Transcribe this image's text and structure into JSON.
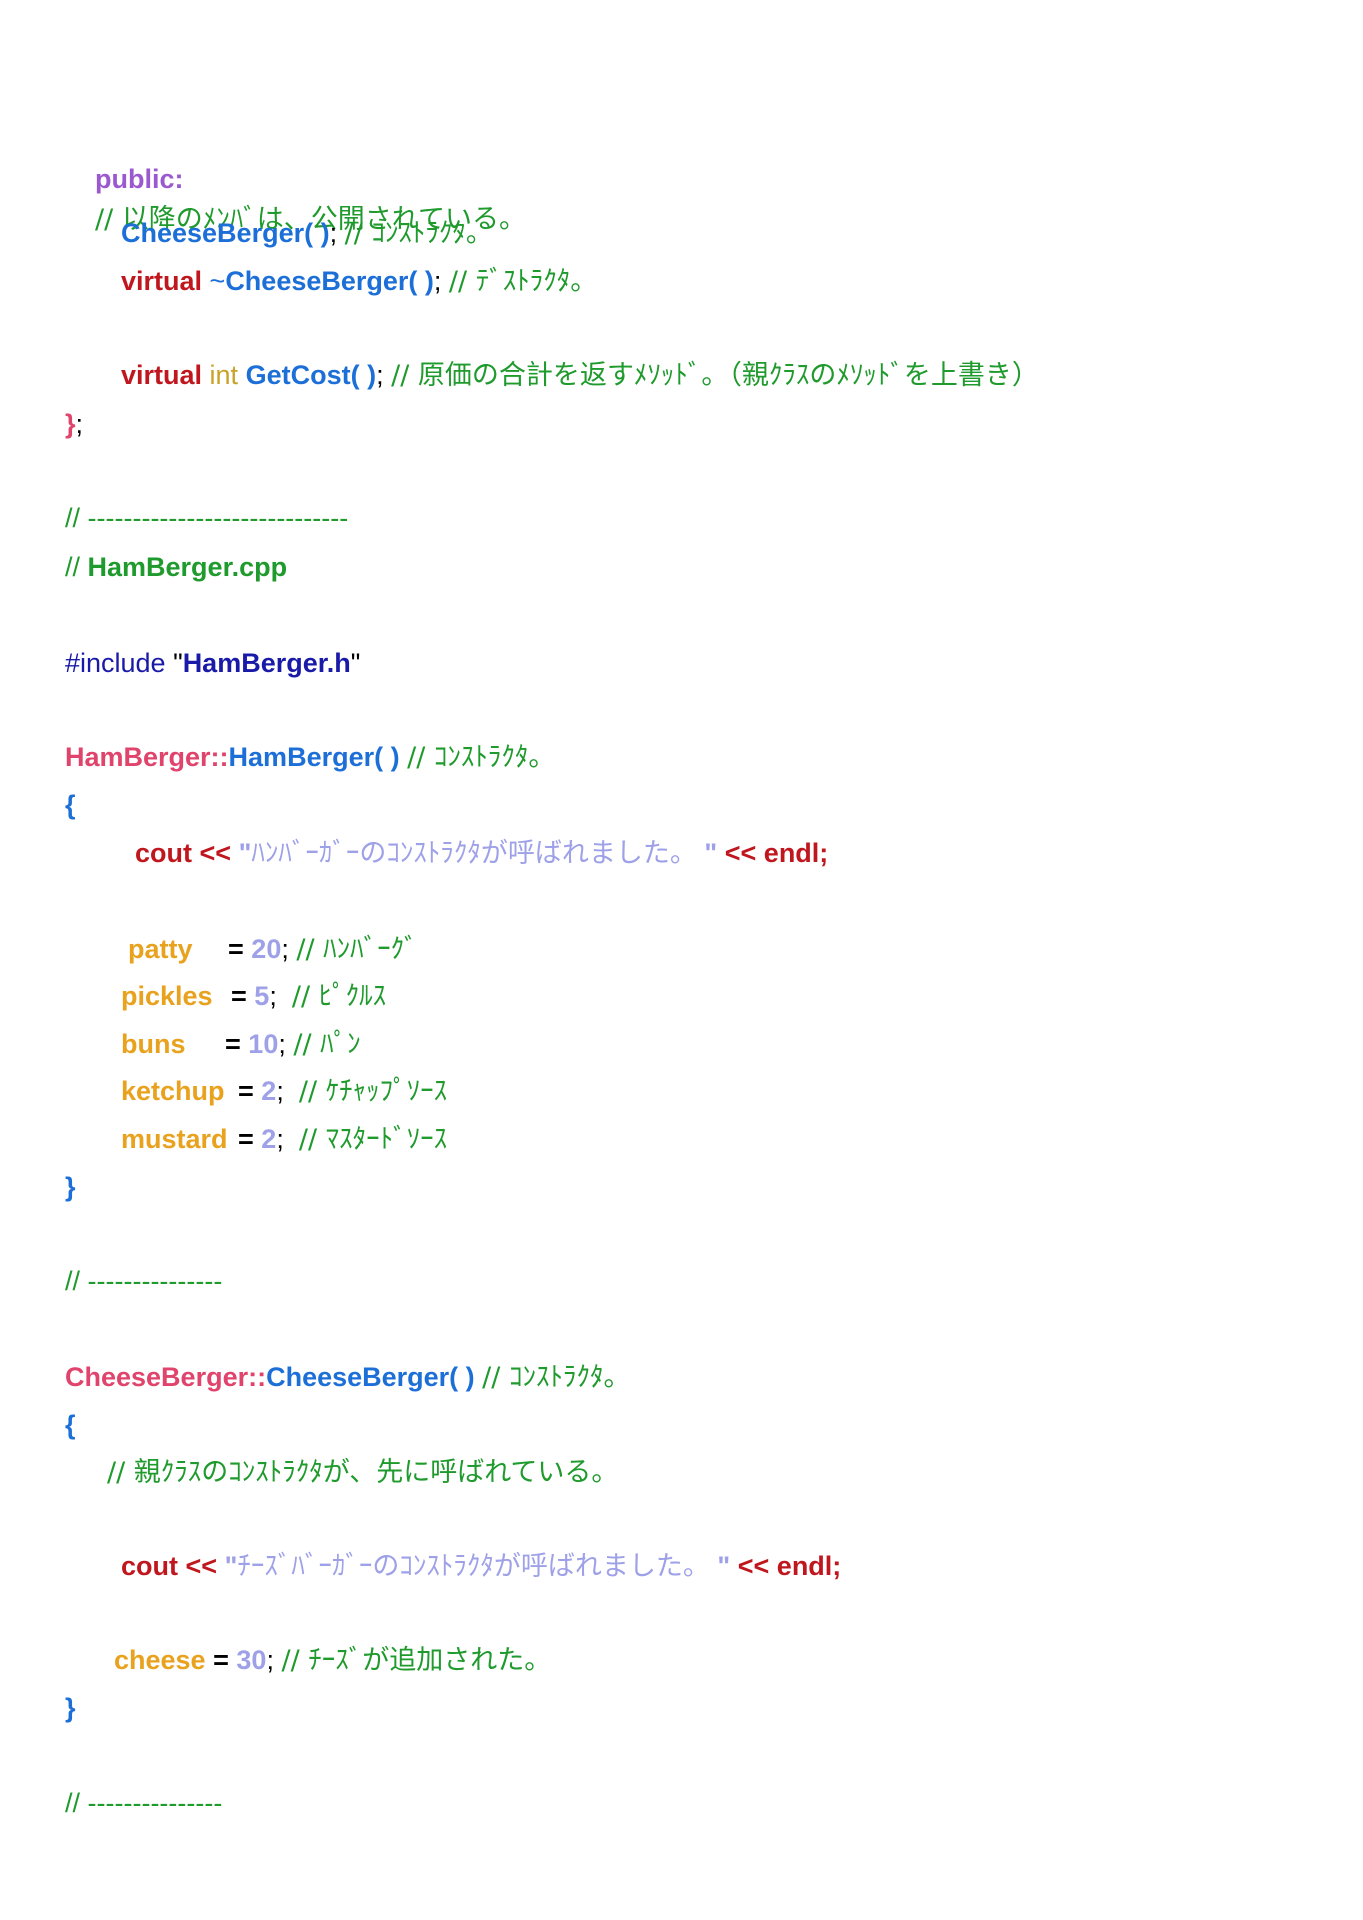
{
  "code": {
    "l1": {
      "kw": "public:",
      "comment": "// 以降のﾒﾝﾊﾞは、公開されている。"
    },
    "l2": {
      "ctor": "CheeseBerger( )",
      "semi": ";",
      "comment": "// ｺﾝｽﾄﾗｸﾀ。"
    },
    "l3": {
      "kw": "virtual",
      "tilde": " ~",
      "dtor": "CheeseBerger( )",
      "semi": ";",
      "comment": "// ﾃﾞｽﾄﾗｸﾀ。"
    },
    "l4": {
      "kw": "virtual",
      "type": "int",
      "fn": "GetCost( )",
      "semi": ";",
      "comment": "// 原価の合計を返すﾒｿｯﾄﾞ。（親ｸﾗｽのﾒｿｯﾄﾞを上書き）"
    },
    "l5": {
      "brace": "}",
      "semi": ";"
    },
    "l6": {
      "comment": "// -----------------------------"
    },
    "l7": {
      "slashes": "// ",
      "file": "HamBerger.cpp"
    },
    "l8": {
      "directive": "#include ",
      "q1": "\"",
      "file": "HamBerger.h",
      "q2": "\""
    },
    "l9": {
      "scope": "HamBerger::",
      "fn": "HamBerger( )",
      "comment": "// ｺﾝｽﾄﾗｸﾀ。"
    },
    "l10": {
      "brace": "{"
    },
    "l11": {
      "cout": "cout",
      "op": "<<",
      "q1": "\"",
      "str": "ﾊﾝﾊﾞｰｶﾞｰのｺﾝｽﾄﾗｸﾀが呼ばれました。",
      "q2": "\"",
      "op2": "<<",
      "endl": "endl;"
    },
    "fields1": [
      {
        "name": "patty",
        "eq": "=",
        "val": "20",
        "semi": ";",
        "comment": "// ﾊﾝﾊﾞｰｸﾞ"
      },
      {
        "name": "pickles",
        "eq": "=",
        "val": "5",
        "semi": ";",
        "comment": "// ﾋﾟｸﾙｽ"
      },
      {
        "name": "buns",
        "eq": "=",
        "val": "10",
        "semi": ";",
        "comment": "// ﾊﾟﾝ"
      },
      {
        "name": "ketchup",
        "eq": "=",
        "val": "2",
        "semi": ";",
        "comment": "// ｹﾁｬｯﾌﾟｿｰｽ"
      },
      {
        "name": "mustard",
        "eq": "=",
        "val": "2",
        "semi": ";",
        "comment": "// ﾏｽﾀｰﾄﾞｿｰｽ"
      }
    ],
    "l17": {
      "brace": "}"
    },
    "l18": {
      "comment": "// ---------------"
    },
    "l19": {
      "scope": "CheeseBerger::",
      "fn": "CheeseBerger( )",
      "comment": "// ｺﾝｽﾄﾗｸﾀ。"
    },
    "l20": {
      "brace": "{"
    },
    "l21": {
      "comment": "// 親ｸﾗｽのｺﾝｽﾄﾗｸﾀが、先に呼ばれている。"
    },
    "l22": {
      "cout": "cout",
      "op": "<<",
      "q1": "\"",
      "str": "ﾁｰｽﾞﾊﾞｰｶﾞｰのｺﾝｽﾄﾗｸﾀが呼ばれました。",
      "q2": "\"",
      "op2": "<<",
      "endl": "endl;"
    },
    "l23": {
      "name": "cheese",
      "eq": "=",
      "val": "30",
      "semi": ";",
      "comment": "// ﾁｰｽﾞが追加された。"
    },
    "l24": {
      "brace": "}"
    },
    "l25": {
      "comment": "// ---------------"
    }
  }
}
